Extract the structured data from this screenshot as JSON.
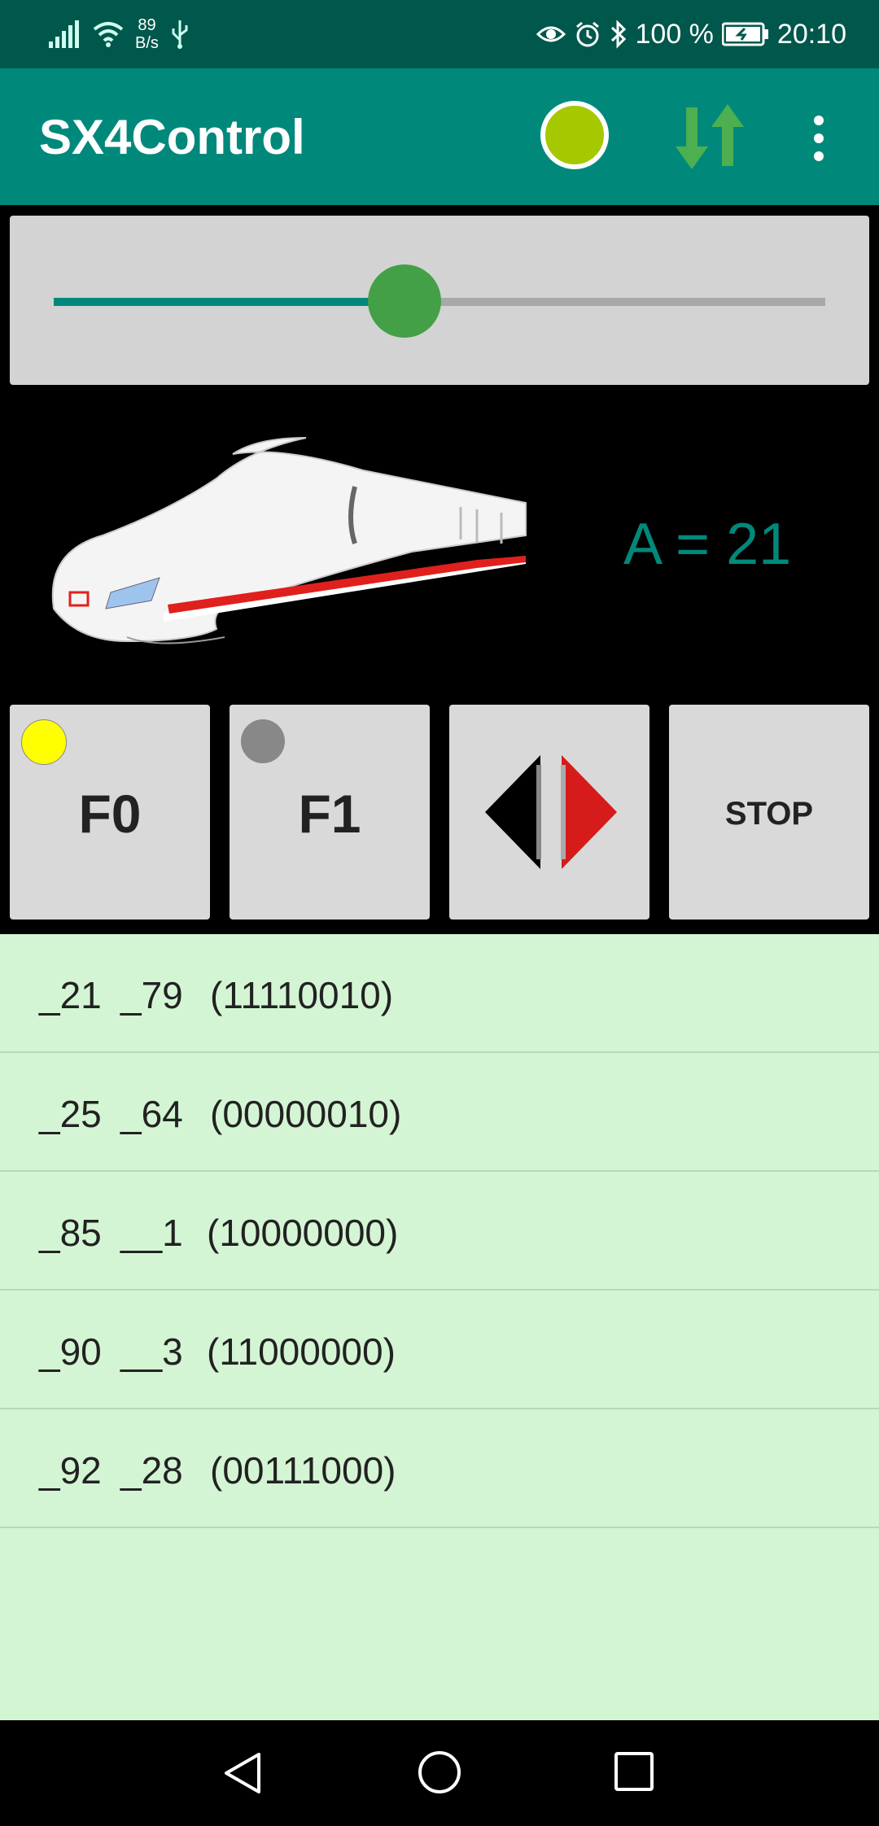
{
  "status_bar": {
    "net_speed_value": "89",
    "net_speed_unit": "B/s",
    "battery": "100 %",
    "time": "20:10",
    "icons": [
      "signal-icon",
      "wifi-icon",
      "usb-icon",
      "eye-icon",
      "alarm-icon",
      "bluetooth-icon",
      "battery-icon"
    ]
  },
  "app_bar": {
    "title": "SX4Control",
    "status_color": "#a6c800",
    "accent": "#00897B"
  },
  "speed_slider": {
    "value_fraction": 0.455
  },
  "loco": {
    "address_text": "A = 21"
  },
  "buttons": {
    "f0_label": "F0",
    "f0_indicator": "#ffff00",
    "f1_label": "F1",
    "f1_indicator": "#888888",
    "stop_label": "STOP"
  },
  "channels": [
    {
      "addr": "_21",
      "val": "_79",
      "bits": "(11110010)"
    },
    {
      "addr": "_25",
      "val": "_64",
      "bits": "(00000010)"
    },
    {
      "addr": "_85",
      "val": "__1",
      "bits": "(10000000)"
    },
    {
      "addr": "_90",
      "val": "__3",
      "bits": "(11000000)"
    },
    {
      "addr": "_92",
      "val": "_28",
      "bits": "(00111000)"
    }
  ]
}
